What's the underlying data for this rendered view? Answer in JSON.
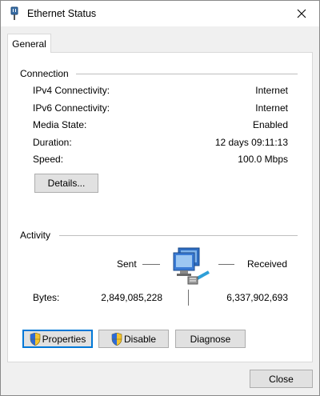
{
  "window": {
    "title": "Ethernet Status",
    "close_icon": "close-icon"
  },
  "tabs": [
    {
      "label": "General",
      "active": true
    }
  ],
  "connection": {
    "heading": "Connection",
    "rows": [
      {
        "label": "IPv4 Connectivity:",
        "value": "Internet"
      },
      {
        "label": "IPv6 Connectivity:",
        "value": "Internet"
      },
      {
        "label": "Media State:",
        "value": "Enabled"
      },
      {
        "label": "Duration:",
        "value": "12 days 09:11:13"
      },
      {
        "label": "Speed:",
        "value": "100.0 Mbps"
      }
    ],
    "details_button": "Details..."
  },
  "activity": {
    "heading": "Activity",
    "sent_label": "Sent",
    "received_label": "Received",
    "bytes_label": "Bytes:",
    "bytes_sent": "2,849,085,228",
    "bytes_received": "6,337,902,693",
    "network_icon": "network-computers-icon"
  },
  "buttons": {
    "properties": "Properties",
    "disable": "Disable",
    "diagnose": "Diagnose",
    "close": "Close"
  },
  "colors": {
    "accent": "#0078d7",
    "panel": "#ffffff",
    "chrome": "#f0f0f0"
  }
}
